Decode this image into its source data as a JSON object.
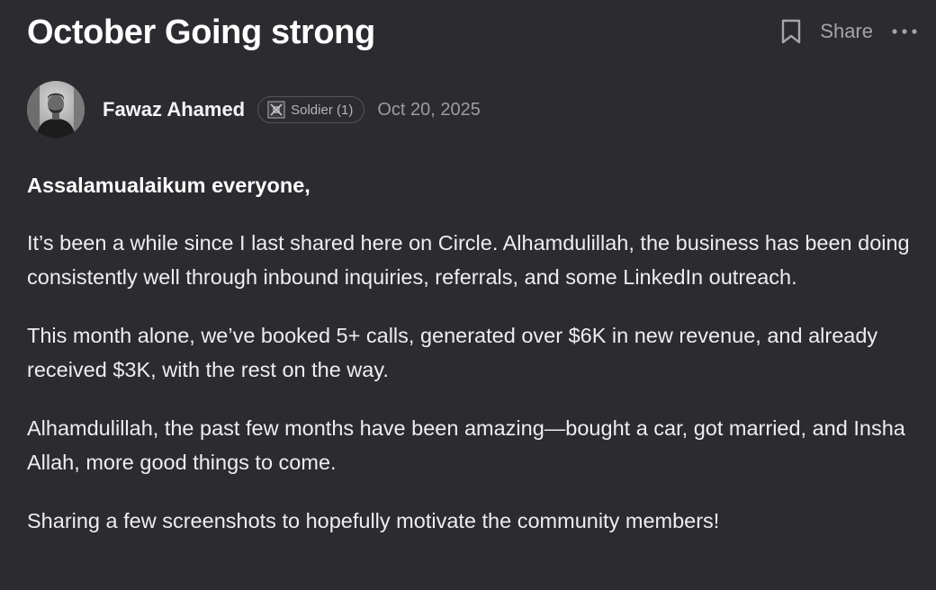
{
  "post": {
    "title": "October Going strong",
    "actions": {
      "bookmark_icon": "bookmark-icon",
      "share_label": "Share",
      "more_icon": "more-horizontal-icon"
    },
    "author": {
      "name": "Fawaz Ahamed",
      "badge_icon": "soldier-badge-icon",
      "badge_label": "Soldier (1)",
      "date": "Oct 20, 2025"
    },
    "body": {
      "greeting": "Assalamualaikum everyone,",
      "paragraphs": [
        "It’s been a while since I last shared here on Circle. Alhamdulillah, the business has been doing consistently well through inbound inquiries, referrals, and some LinkedIn outreach.",
        "This month alone, we’ve booked 5+ calls, generated over $6K in new revenue, and already received $3K, with the rest on the way.",
        "Alhamdulillah, the past few months have been amazing—bought a car, got married, and Insha Allah, more good things to come.",
        "Sharing a few screenshots to hopefully motivate the community members!"
      ]
    }
  },
  "colors": {
    "background": "#2b2b30",
    "text": "#eeeef0",
    "muted": "#9c9ca3",
    "badge_border": "#55555c"
  }
}
